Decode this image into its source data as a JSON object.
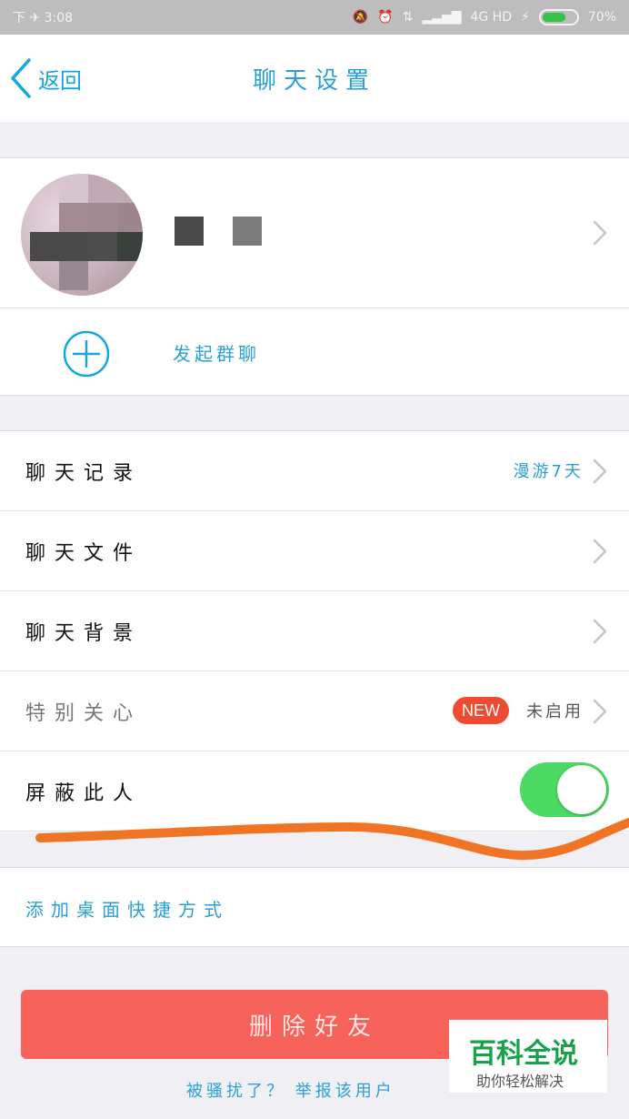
{
  "status_bar": {
    "left_text": "下 ✈ 3:08",
    "network": "4G HD",
    "battery": "70%",
    "battery_level": 0.7
  },
  "nav": {
    "back_label": "返回",
    "title": "聊天设置"
  },
  "profile": {
    "avatar_color": "#c9b3bc",
    "add_group_label": "发起群聊"
  },
  "settings": {
    "items": [
      {
        "label": "聊天记录",
        "value": "漫游7天"
      },
      {
        "label": "聊天文件",
        "value": ""
      },
      {
        "label": "聊天背景",
        "value": ""
      },
      {
        "label": "特别关心",
        "badge": "NEW",
        "value": "未启用"
      },
      {
        "label": "屏蔽此人",
        "toggle_on": true
      }
    ]
  },
  "shortcut": {
    "label": "添加桌面快捷方式"
  },
  "actions": {
    "delete_label": "删除好友",
    "report_label": "被骚扰了？ 举报该用户"
  },
  "watermark": {
    "title": "百科全说",
    "subtitle": "助你轻松解决"
  },
  "colors": {
    "accent": "#2a9fd6",
    "toggle_on": "#4cd964",
    "danger": "#f7625a",
    "badge": "#ef4b32",
    "annotation_stroke": "#f07424"
  }
}
